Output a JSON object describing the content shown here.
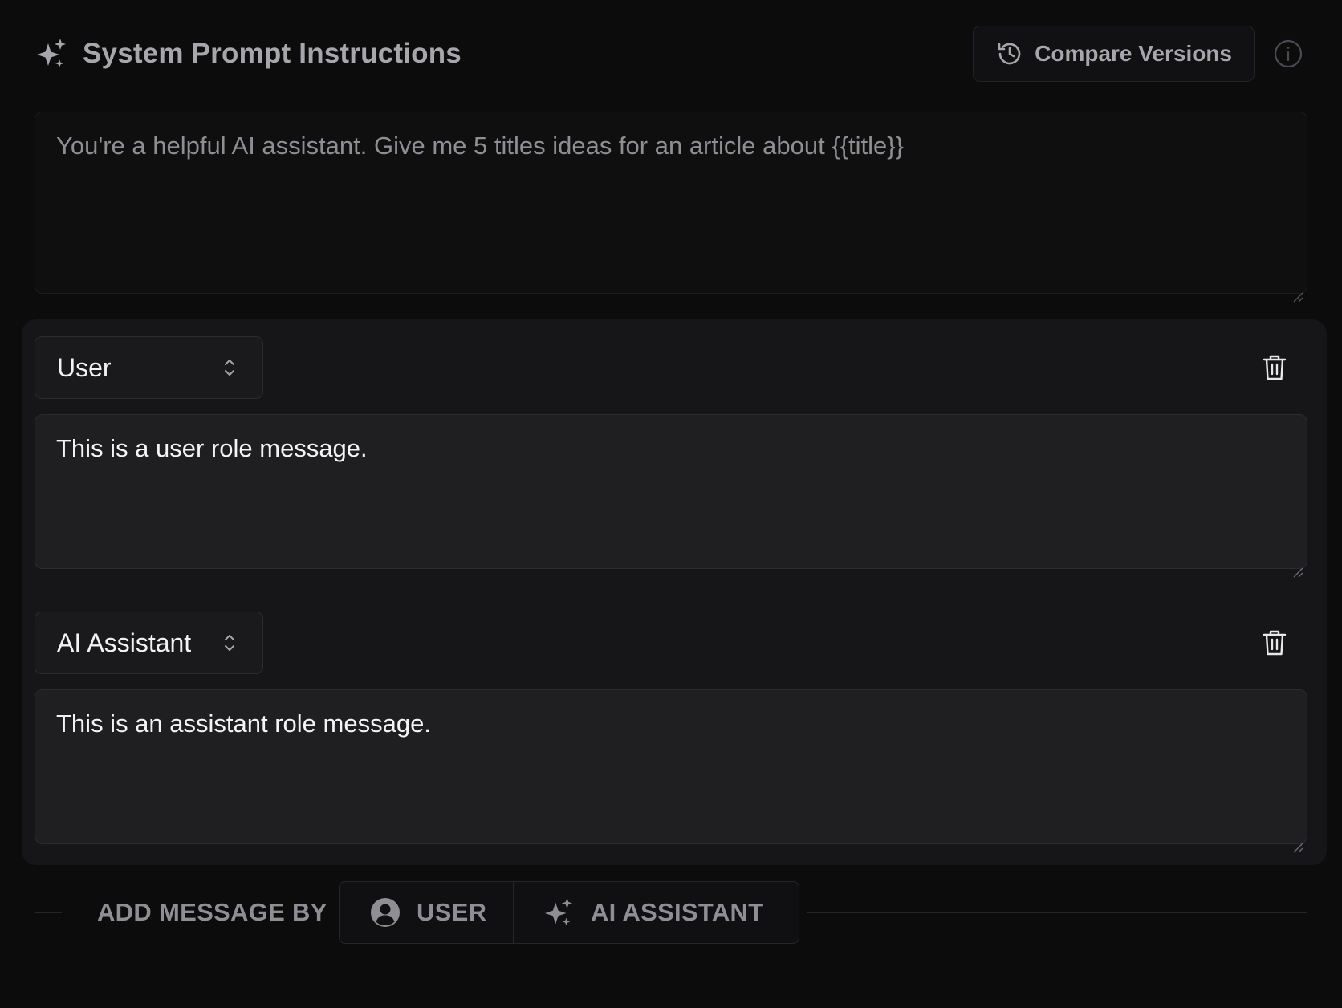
{
  "header": {
    "title": "System Prompt Instructions",
    "title_icon": "sparkle-icon",
    "compare_label": "Compare Versions",
    "compare_icon": "history-icon",
    "info_icon": "info-icon"
  },
  "system_prompt": {
    "text": "You're a helpful AI assistant. Give me 5 titles ideas for an article about {{title}}"
  },
  "messages": [
    {
      "role": "User",
      "text": "This is a user role message."
    },
    {
      "role": "AI Assistant",
      "text": "This is an assistant role message."
    }
  ],
  "add_message": {
    "label": "ADD MESSAGE BY",
    "user_label": "USER",
    "assistant_label": "AI ASSISTANT"
  },
  "colors": {
    "background": "#0c0c0d",
    "panel": "#161618",
    "muted_text": "#8e8e93",
    "primary_text": "#f2f2f4"
  }
}
